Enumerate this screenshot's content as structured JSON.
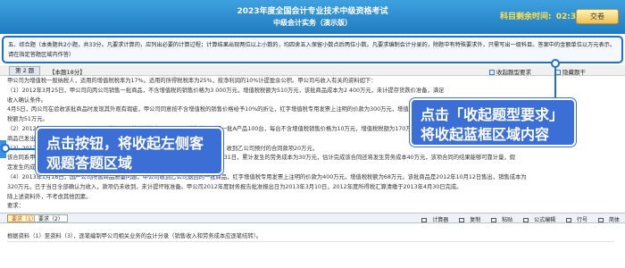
{
  "header": {
    "title": "2023年度全国会计专业技术中级资格考试",
    "subtitle": "中级会计实务（演示版）",
    "timer_label": "科目剩余时间:",
    "timer_value": "02:33:36",
    "submit_label": "交卷"
  },
  "instruction": "五、综合题（本类题共2小题，共33分。凡要求计算的，应列出必要的计算过程；计算结果出现两位以上小数的，均四舍五入保留小数点后两位小数。凡要求编制会计分录的，除题中有特殊要求外，只需写出一级科目。答案中的金额单位以万元表示。请在指定答题区域内作答）",
  "question_header": {
    "number": "第 2 题",
    "score": "【本题18分】",
    "collapse_label": "收起题型要求",
    "hide_label": "隐藏题干"
  },
  "content_lines": [
    "甲公司为增值税一般纳税人，适用的增值税税率为17%。适用的所得税税率为25%，按净利润的10%计提盈余公积。甲公司与收入有关的资料如下：",
    "（1）2012年3月25日，甲公司向丙公司销售一批商品，不含增值税的销售价格为3 000万元，增值税税额为510万元，该批商品成本为2 400万元，未计提存货跌价准备，满足",
    "收入确认条件。",
    "4月5日，丙公司在验收该批商品时发现其外观有瑕疵，甲公司同意按不含增值税的销售价格给予10%的折让，红字增值税专用发票上注明的价款为300万元，增值税",
    "税额为51万元。",
    "（2）2012年9月10日，甲公司与丁公司签订一项特殊销售合同。甲公司销售给丁公司一批A产品100台，每台不含增值税销售价格为10万元，增值税税额为170万元，该批",
    "商品已发出，货款已收存银行，该批商品的实际成本为1 200万元，款项均已收讫。",
    "（3）2012年10月15日，甲公司为乙公司提供安装服务，合同总收入为50万元，当日，收到乙公司预付的合同款项20万元，",
    "该合同系甲公司于2012年11月1日开工，全部服务预计于2013年3月1日完工，至12月31日，累计发生的劳务成本为30万元，估计完成该合同还将发生劳务成本40万元，该项合同的结果能够可靠计量，假",
    "定发生的成本全部为人工成本。",
    "（4）2013年1月18日，国产公司所售商品质量问题，甲公司收到乙公司退回的一批商品，红字增值税专用发票上注明的价款为400万元，增值税税额为68万元，该批商品是2012年10月12日售出，销售成本为",
    "320万元，已于当日全部确认为收入，款项仍未收到，未计提坏账准备。甲公司2012年度财务报告批准报出日为2013年3月10日，2012年度所得税汇算清缴于2013年4月30日完成。",
    "除上述资料外，不考虑其他因素。",
    "要求："
  ],
  "callouts": {
    "left": "点击按钮，将收起左侧客观题答题区域",
    "right": "点击「收起题型要求」将收起蓝框区域内容"
  },
  "bottom_bar": {
    "tabs": [
      "要求（1）",
      "要求（2）"
    ],
    "tools": [
      "计算器",
      "复制",
      "粘贴",
      "公式编辑",
      "行号",
      "简体"
    ]
  },
  "answer_line": "根据资料（1）至资料（3），逐笔编制甲公司相关业务的会计分录（销售收入和劳务成本应逐笔结转）。"
}
